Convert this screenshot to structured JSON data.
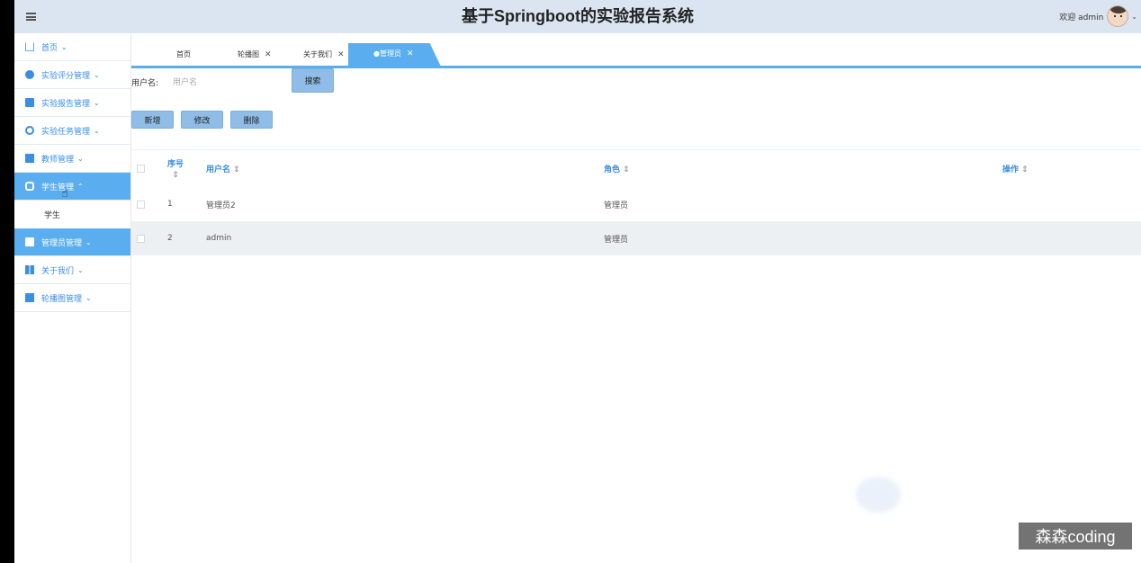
{
  "header": {
    "title": "基于Springboot的实验报告系统",
    "welcome": "欢迎 admin",
    "caret": "⌄"
  },
  "sidebar": {
    "items": [
      {
        "label": "首页",
        "icon": "home-icon"
      },
      {
        "label": "实验评分管理",
        "icon": "circle-icon"
      },
      {
        "label": "实验报告管理",
        "icon": "book-icon"
      },
      {
        "label": "实验任务管理",
        "icon": "gear-icon"
      },
      {
        "label": "教师管理",
        "icon": "card-icon"
      },
      {
        "label": "学生管理",
        "icon": "lock-icon",
        "expanded": true
      },
      {
        "label": "管理员管理",
        "icon": "bag-icon"
      },
      {
        "label": "关于我们",
        "icon": "building-icon"
      },
      {
        "label": "轮播图管理",
        "icon": "image-icon"
      }
    ],
    "sub_item": "学生",
    "chevron_down": "⌄",
    "chevron_up": "⌃"
  },
  "tabs": [
    {
      "label": "首页"
    },
    {
      "label": "轮播图"
    },
    {
      "label": "关于我们"
    },
    {
      "label": "●管理员"
    }
  ],
  "tab_close": "✕",
  "search": {
    "label": "用户名:",
    "placeholder": "用户名",
    "button": "搜索"
  },
  "actions": {
    "add": "新增",
    "edit": "修改",
    "delete": "删除"
  },
  "table": {
    "columns": {
      "index": "序号",
      "username": "用户名",
      "role": "角色",
      "op": "操作"
    },
    "sort_glyph": "⇕",
    "rows": [
      {
        "index": "1",
        "username": "管理员2",
        "role": "管理员"
      },
      {
        "index": "2",
        "username": "admin",
        "role": "管理员"
      }
    ]
  },
  "watermark": "森森coding",
  "colors": {
    "accent": "#5aaef0",
    "header_bg": "#dbe5f1",
    "link": "#3a8ee6"
  }
}
